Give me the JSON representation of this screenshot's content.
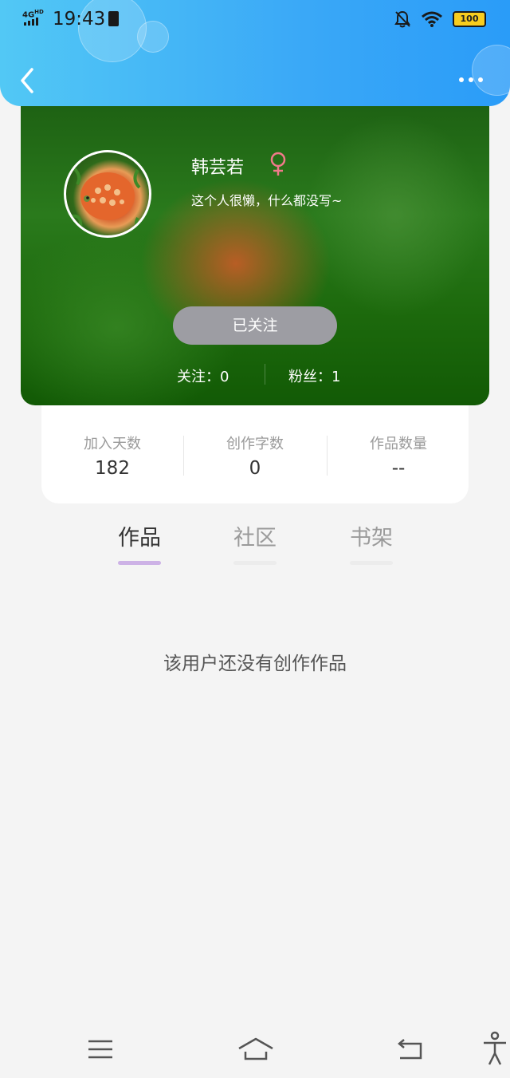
{
  "status_bar": {
    "network": "4G",
    "network_hd": "HD",
    "time": "19:43",
    "battery": "100"
  },
  "header": {
    "back_icon": "chevron-left-icon",
    "more_icon": "more-dots-icon"
  },
  "profile": {
    "name": "韩芸若",
    "gender_icon": "female-icon",
    "gender_color": "#f07a8a",
    "bio": "这个人很懒，什么都没写~",
    "follow_button": "已关注",
    "following": "关注：0",
    "fans": "粉丝：1"
  },
  "stats": [
    {
      "label": "加入天数",
      "value": "182"
    },
    {
      "label": "创作字数",
      "value": "0"
    },
    {
      "label": "作品数量",
      "value": "--"
    }
  ],
  "tabs": [
    {
      "label": "作品",
      "active": true
    },
    {
      "label": "社区",
      "active": false
    },
    {
      "label": "书架",
      "active": false
    }
  ],
  "empty_message": "该用户还没有创作作品",
  "nav_bar": {
    "icons": [
      "menu-icon",
      "home-icon",
      "back-icon",
      "accessibility-icon"
    ]
  },
  "colors": {
    "header_gradient_start": "#52c8f5",
    "header_gradient_end": "#2a9cf8",
    "active_tab_underline": "#cdb2e6",
    "follow_button_bg": "#9d9da3"
  }
}
